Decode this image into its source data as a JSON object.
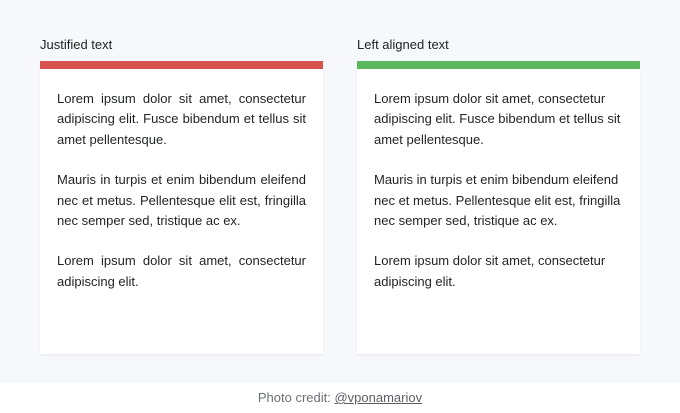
{
  "columns": [
    {
      "title": "Justified text",
      "accent": "#d9534f",
      "alignment": "justify",
      "paragraphs": [
        "Lorem ipsum dolor sit amet, consectetur adipiscing elit. Fusce bibendum et tellus sit amet pellentesque.",
        "Mauris in turpis et enim bibendum eleifend nec et metus. Pellentesque elit est, fringilla nec semper sed, tristique ac ex.",
        "Lorem ipsum dolor sit amet, consectetur adipiscing elit."
      ]
    },
    {
      "title": "Left aligned text",
      "accent": "#5cb85c",
      "alignment": "left",
      "paragraphs": [
        "Lorem ipsum dolor sit amet, consectetur adipiscing elit. Fusce bibendum et tellus sit amet pellentesque.",
        "Mauris in turpis et enim bibendum eleifend nec et metus. Pellentesque elit est, fringilla nec semper sed, tristique ac ex.",
        "Lorem ipsum dolor sit amet, consectetur adipiscing elit."
      ]
    }
  ],
  "footer": {
    "prefix": "Photo credit: ",
    "link": "@vponamariov"
  }
}
